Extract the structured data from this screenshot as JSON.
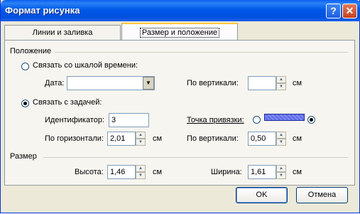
{
  "window": {
    "title": "Формат рисунка",
    "help_label": "?",
    "close_label": "✕"
  },
  "tabs": [
    {
      "label": "Линии и заливка"
    },
    {
      "label": "Размер и положение"
    }
  ],
  "position": {
    "group_label": "Положение",
    "link_timeline": {
      "label": "Связать со шкалой времени:",
      "selected": false
    },
    "date_label": "Дата:",
    "date_value": "",
    "vert_label_1": "По вертикали:",
    "vert_value_1": "",
    "unit": "см",
    "link_task": {
      "label": "Связать с задачей:",
      "selected": true
    },
    "id_label": "Идентификатор:",
    "id_value": "3",
    "anchor_label": "Точка привязки:",
    "horiz_label": "По горизонтали:",
    "horiz_value": "2,01",
    "vert_label_2": "По вертикали:",
    "vert_value_2": "0,50"
  },
  "size": {
    "group_label": "Размер",
    "height_label": "Высота:",
    "height_value": "1,46",
    "width_label": "Ширина:",
    "width_value": "1,61",
    "unit": "см"
  },
  "buttons": {
    "ok": "OK",
    "cancel": "Отмена"
  }
}
